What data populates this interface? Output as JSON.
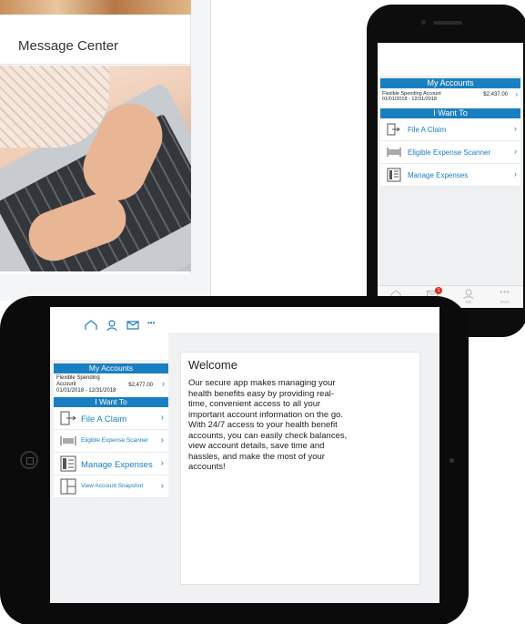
{
  "desktop": {
    "message_center_title": "Message Center"
  },
  "colors": {
    "brand_blue": "#1a7fc1",
    "badge_red": "#e0301e"
  },
  "phone": {
    "my_accounts_header": "My Accounts",
    "account": {
      "name": "Flexible Spending Account",
      "dates": "01/01/2018 - 12/31/2018",
      "amount": "$2,437.00"
    },
    "i_want_to_header": "I Want To",
    "actions": [
      {
        "label": "File A Claim",
        "icon": "file-claim-icon"
      },
      {
        "label": "Eligible Expense Scanner",
        "icon": "barcode-scanner-icon"
      },
      {
        "label": "Manage Expenses",
        "icon": "expense-list-icon"
      }
    ],
    "tabbar": [
      {
        "label": "Home",
        "icon": "home-icon"
      },
      {
        "label": "Messages",
        "icon": "envelope-icon",
        "badge": "1"
      },
      {
        "label": "Me",
        "icon": "person-icon"
      },
      {
        "label": "More",
        "icon": "more-dots-icon"
      }
    ]
  },
  "tablet": {
    "header_icons": [
      "home-icon",
      "person-icon",
      "envelope-icon",
      "more-dots-icon"
    ],
    "my_accounts_header": "My Accounts",
    "account": {
      "name_line1": "Flexible Spending",
      "name_line2": "Account",
      "dates": "01/01/2018 - 12/31/2018",
      "amount": "$2,477.00"
    },
    "i_want_to_header": "I Want To",
    "actions": [
      {
        "label": "File A Claim",
        "icon": "file-claim-icon"
      },
      {
        "label": "Eligible Expense Scanner",
        "icon": "barcode-scanner-icon"
      },
      {
        "label": "Manage Expenses",
        "icon": "expense-list-icon"
      },
      {
        "label": "View Account Snapshot",
        "icon": "account-snapshot-icon"
      }
    ],
    "welcome": {
      "title": "Welcome",
      "body": "Our secure app makes managing your health benefits easy by providing real-time, convenient access to all your important account information on the go. With 24/7 access to your health benefit accounts, you can easily check balances, view account details, save time and hassles, and make the most of your accounts!"
    }
  }
}
